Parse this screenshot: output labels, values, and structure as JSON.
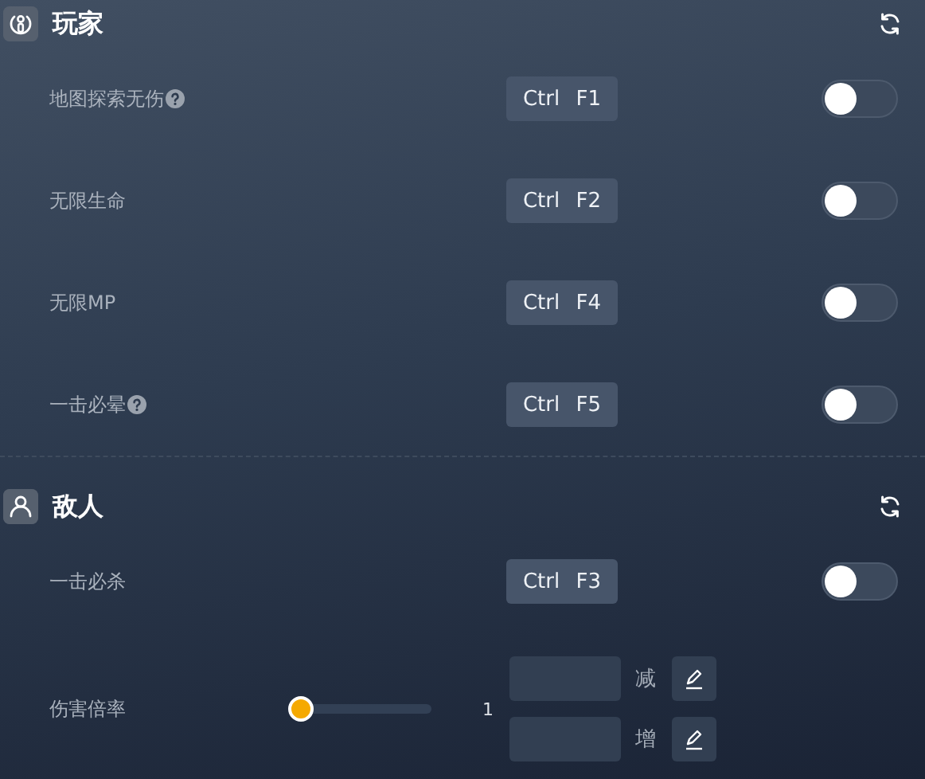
{
  "sections": [
    {
      "title": "玩家",
      "items": [
        {
          "kind": "toggle",
          "label": "地图探索无伤",
          "help": true,
          "shortcut": "Ctrl F1",
          "on": false
        },
        {
          "kind": "toggle",
          "label": "无限生命",
          "help": false,
          "shortcut": "Ctrl F2",
          "on": false
        },
        {
          "kind": "toggle",
          "label": "无限MP",
          "help": false,
          "shortcut": "Ctrl F4",
          "on": false
        },
        {
          "kind": "toggle",
          "label": "一击必晕",
          "help": true,
          "shortcut": "Ctrl F5",
          "on": false
        }
      ]
    },
    {
      "title": "敌人",
      "items": [
        {
          "kind": "toggle",
          "label": "一击必杀",
          "help": false,
          "shortcut": "Ctrl F3",
          "on": false
        },
        {
          "kind": "slider",
          "label": "伤害倍率",
          "level": 0,
          "reading": "1",
          "hotkeys": [
            {
              "label": "减"
            },
            {
              "label": "增"
            }
          ]
        }
      ]
    }
  ]
}
